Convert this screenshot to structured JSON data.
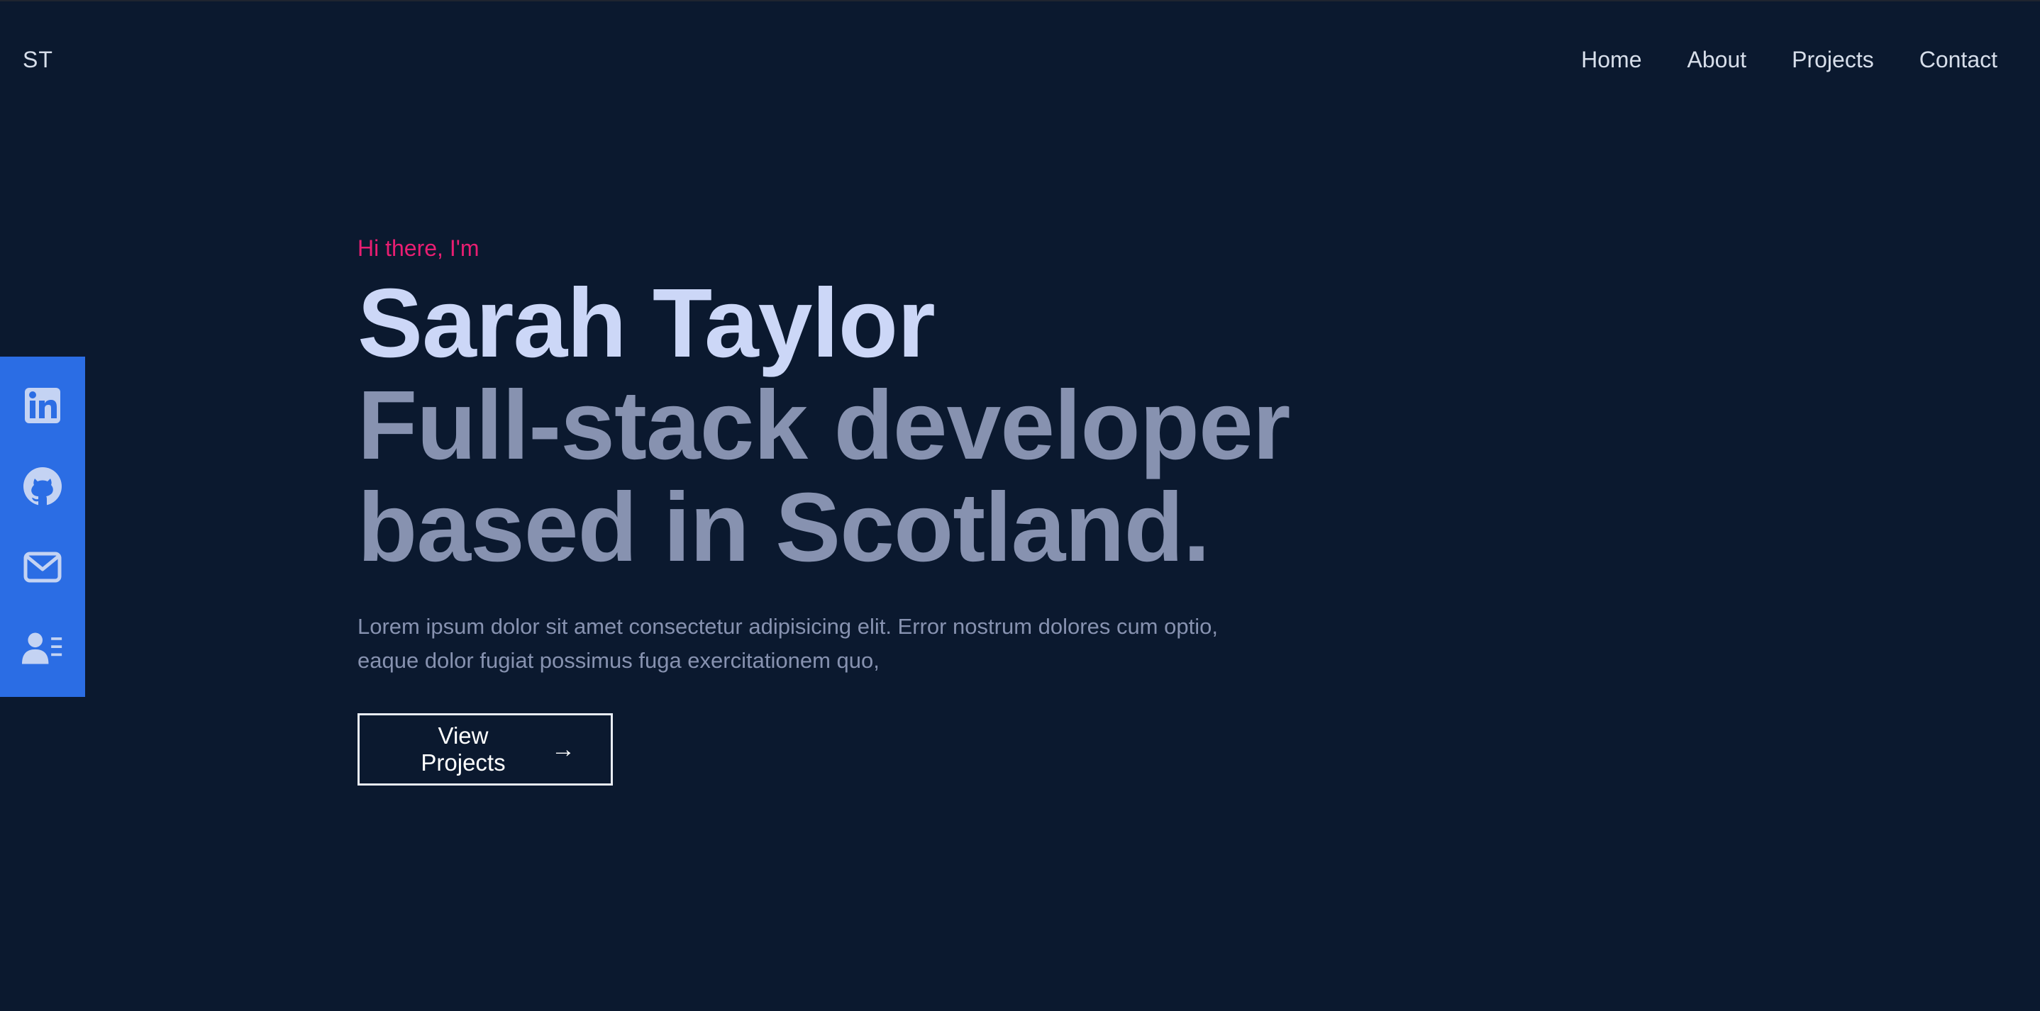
{
  "header": {
    "logo": "ST",
    "nav": [
      {
        "label": "Home"
      },
      {
        "label": "About"
      },
      {
        "label": "Projects"
      },
      {
        "label": "Contact"
      }
    ]
  },
  "social": {
    "color": "#2b6de4",
    "icons": [
      "linkedin-icon",
      "github-icon",
      "mail-icon",
      "contact-card-icon"
    ]
  },
  "hero": {
    "greeting": "Hi there, I'm",
    "name": "Sarah Taylor",
    "tagline_line1": "Full-stack developer",
    "tagline_line2": "based in Scotland.",
    "description_line1": "Lorem ipsum dolor sit amet consectetur adipisicing elit. Error nostrum dolores cum optio,",
    "description_line2": "eaque dolor fugiat possimus fuga exercitationem quo,",
    "cta_label": "View Projects",
    "cta_arrow": "→"
  },
  "colors": {
    "background": "#0b192f",
    "accent": "#e91e72",
    "heading": "#ccd7f7",
    "muted": "#8792b0"
  }
}
